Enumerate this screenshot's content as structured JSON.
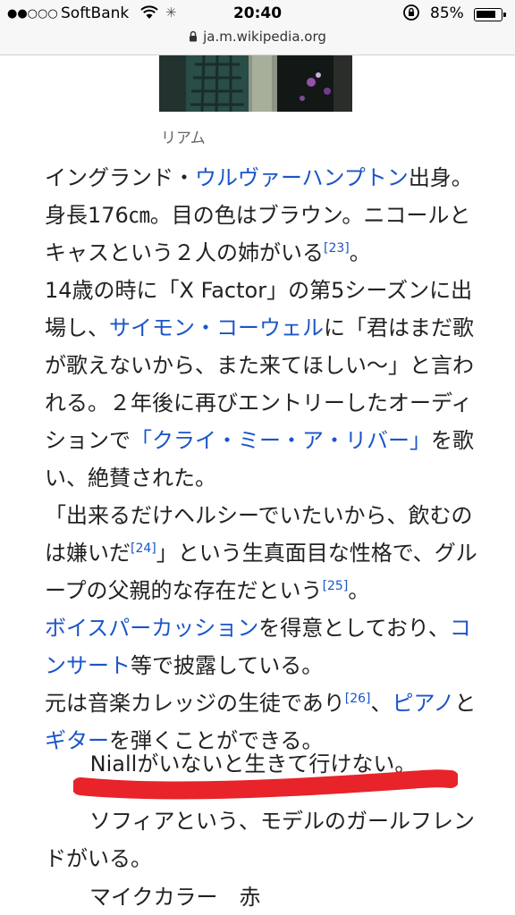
{
  "status_bar": {
    "signal": "●●○○○",
    "carrier": "SoftBank",
    "time": "20:40",
    "battery_percent": "85%",
    "battery_level": 0.85
  },
  "url": "ja.m.wikipedia.org",
  "image_caption": "リアム",
  "article": {
    "p1": {
      "t1": "イングランド・",
      "link1": "ウルヴァーハンプトン",
      "t2": "出身。身長176㎝。目の色はブラウン。ニコールとキャスという２人の姉がいる",
      "ref1": "[23]",
      "t3": "。"
    },
    "p2": {
      "t1": "14歳の時に「X Factor」の第5シーズンに出場し、",
      "link1": "サイモン・コーウェル",
      "t2": "に「君はまだ歌が歌えないから、また来てほしい〜」と言われる。２年後に再びエントリーしたオーディションで",
      "link2": "「クライ・ミー・ア・リバー」",
      "t3": "を歌い、絶賛された。"
    },
    "p3": {
      "t1": "「出来るだけヘルシーでいたいから、飲むのは嫌いだ",
      "ref1": "[24]",
      "t2": "」という生真面目な性格で、グループの父親的な存在だという",
      "ref2": "[25]",
      "t3": "。"
    },
    "p4": {
      "link1": "ボイスパーカッション",
      "t1": "を得意としており、",
      "link2": "コンサート",
      "t2": "等で披露している。"
    },
    "p5": {
      "t1": "元は音楽カレッジの生徒であり",
      "ref1": "[26]",
      "t2": "、",
      "link1": "ピアノ",
      "t3": "と",
      "link2": "ギター",
      "t4": "を弾くことができる。"
    }
  },
  "annotations": {
    "line1": "Niallがいないと生きて行けない。",
    "line2": "ソフィアという、モデルのガールフレンドがいる。",
    "line3": "マイクカラー　赤",
    "underline_color": "#e8232a"
  },
  "colors": {
    "link": "#1a55c8",
    "text": "#222222"
  }
}
